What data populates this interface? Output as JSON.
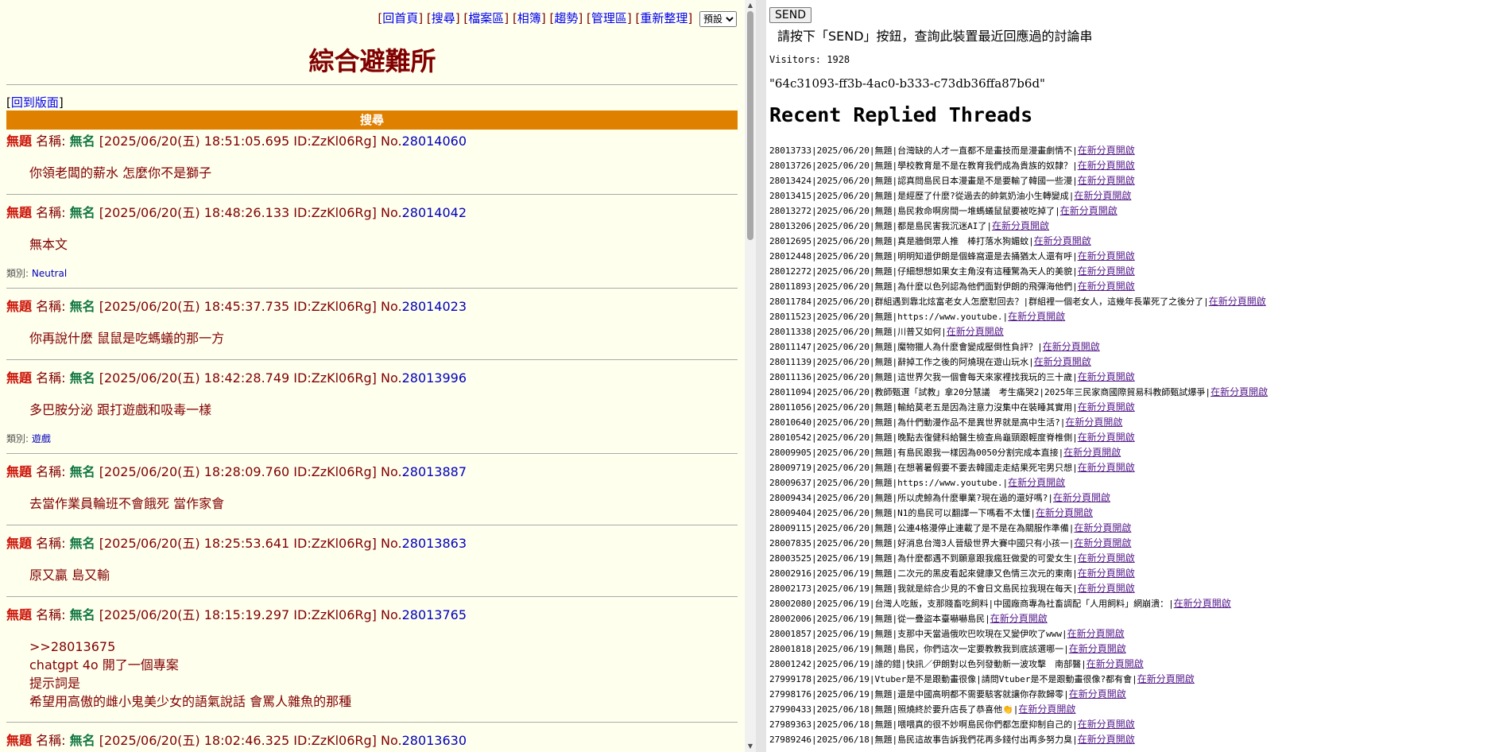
{
  "nav": {
    "home": "回首頁",
    "search": "搜尋",
    "archive": "檔案區",
    "album": "相簿",
    "trend": "趨勢",
    "admin": "管理區",
    "refresh": "重新整理",
    "sort_selected": "預設",
    "open": "[",
    "close": "]"
  },
  "board": {
    "title": "綜合避難所",
    "back_label": "回到版面",
    "search_bar": "搜尋"
  },
  "post_labels": {
    "name_label": "名稱: ",
    "no_prefix": "No.",
    "category_label": "類別: "
  },
  "posts": [
    {
      "subject": "無題",
      "name": "無名",
      "datetime": "[2025/06/20(五) 18:51:05.695 ID:ZzKl06Rg]",
      "no": "28014060",
      "lines": [
        "你領老闆的薪水 怎麼你不是獅子"
      ],
      "category": ""
    },
    {
      "subject": "無題",
      "name": "無名",
      "datetime": "[2025/06/20(五) 18:48:26.133 ID:ZzKl06Rg]",
      "no": "28014042",
      "lines": [
        "無本文"
      ],
      "category": "Neutral"
    },
    {
      "subject": "無題",
      "name": "無名",
      "datetime": "[2025/06/20(五) 18:45:37.735 ID:ZzKl06Rg]",
      "no": "28014023",
      "lines": [
        "你再說什麼 鼠鼠是吃螞蟻的那一方"
      ],
      "category": ""
    },
    {
      "subject": "無題",
      "name": "無名",
      "datetime": "[2025/06/20(五) 18:42:28.749 ID:ZzKl06Rg]",
      "no": "28013996",
      "lines": [
        "多巴胺分泌 跟打遊戲和吸毒一樣"
      ],
      "category": "遊戲"
    },
    {
      "subject": "無題",
      "name": "無名",
      "datetime": "[2025/06/20(五) 18:28:09.760 ID:ZzKl06Rg]",
      "no": "28013887",
      "lines": [
        "去當作業員輪班不會餓死 當作家會"
      ],
      "category": ""
    },
    {
      "subject": "無題",
      "name": "無名",
      "datetime": "[2025/06/20(五) 18:25:53.641 ID:ZzKl06Rg]",
      "no": "28013863",
      "lines": [
        "原又贏 島又輸"
      ],
      "category": ""
    },
    {
      "subject": "無題",
      "name": "無名",
      "datetime": "[2025/06/20(五) 18:15:19.297 ID:ZzKl06Rg]",
      "no": "28013765",
      "lines": [
        ">>28013675",
        "chatgpt 4o 開了一個專案",
        "提示詞是",
        "希望用高傲的雌小鬼美少女的語氣說話 會罵人雜魚的那種"
      ],
      "category": ""
    },
    {
      "subject": "無題",
      "name": "無名",
      "datetime": "[2025/06/20(五) 18:02:46.325 ID:ZzKl06Rg]",
      "no": "28013630",
      "lines": [],
      "category": ""
    }
  ],
  "right": {
    "send": "SEND",
    "prompt": "請按下「SEND」按鈕，查詢此裝置最近回應過的討論串",
    "visitors": "Visitors: 1928",
    "uuid": "\"64c31093-ff3b-4ac0-b333-c73db36ffa87b6d\"",
    "heading": "Recent Replied Threads",
    "link_label": "在新分頁開啟",
    "threads": [
      "28013733|2025/06/20|無題|台灣缺的人才一直都不是畫技而是漫畫劇情不|",
      "28013726|2025/06/20|無題|學校教育是不是在教育我們成為貴族的奴隸？|",
      "28013424|2025/06/20|無題|認真問島民日本漫畫是不是要輸了韓國一些漫|",
      "28013415|2025/06/20|無題|是經歷了什麼?從過去的帥氣奶油小生轉變成|",
      "28013272|2025/06/20|無題|島民救命啊房間一堆螞蟻鼠鼠要被吃掉了|",
      "28013206|2025/06/20|無題|都是島民害我沉迷AI了|",
      "28012695|2025/06/20|無題|真是牆倒眾人推　棒打落水狗媚蚊|",
      "28012448|2025/06/20|無題|明明知道伊朗是個蜂窩還是去捅猶太人還有呼|",
      "28012272|2025/06/20|無題|仔細想想如果女主角沒有這種驚為天人的美貌|",
      "28011893|2025/06/20|無題|為什麼以色列認為他們面對伊朗的飛彈海他們|",
      "28011784|2025/06/20|群組遇到靠北炫富老女人怎麼懟回去？|群組裡一個老女人，這幾年長輩死了之後分了|",
      "28011523|2025/06/20|無題|https://www.youtube.|",
      "28011338|2025/06/20|無題|川普又如何|",
      "28011147|2025/06/20|無題|魔物獵人為什麼會變成壓倒性負評？|",
      "28011139|2025/06/20|無題|辭掉工作之後的阿燒現在遊山玩水|",
      "28011136|2025/06/20|無題|這世界欠我一個會每天來家裡找我玩的三十歲|",
      "28011094|2025/06/20|教師甄選「試教」拿20分慧議　考生痛哭2|2025年三民家商國際貿易科教師甄試爆爭|",
      "28011056|2025/06/20|無題|輸給莫老五是因為注意力沒集中在裝睡其實用|",
      "28010640|2025/06/20|無題|為什們動漫作品不是異世界就是高中生活?|",
      "28010542|2025/06/20|無題|晚點去復健科給醫生檢查烏龜頸跟輕度脊椎側|",
      "28009905|2025/06/20|無題|有島民跟我一樣因為0050分割完成本直接|",
      "28009719|2025/06/20|無題|在想著暑假要不要去韓國走走結果死宅男只想|",
      "28009637|2025/06/20|無題|https://www.youtube.|",
      "28009434|2025/06/20|無題|所以虎鯨為什麼畢業?現在過的還好嗎?|",
      "28009404|2025/06/20|無題|N1的島民可以翻譯一下嗎看不太懂|",
      "28009115|2025/06/20|無題|公連4格漫停止連載了是不是在為關服作準備|",
      "28007835|2025/06/20|無題|好消息台灣3人晉級世界大賽中國只有小孩一|",
      "28003525|2025/06/19|無題|為什麼都遇不到願意跟我瘋狂做愛的可愛女生|",
      "28002916|2025/06/19|無題|二次元的黑皮看起來健康又色情三次元的東南|",
      "28002173|2025/06/19|無題|我就是綜合少見的不會日文島民拉我現在每天|",
      "28002080|2025/06/19|台灣人吃飯，支那賤畜吃飼料|中國廠商專為社畜調配「人用飼料」網崩潰：|",
      "28002006|2025/06/19|無題|從一疊盜本臺嚇嚇島民|",
      "28001857|2025/06/19|無題|支那中天當過俄吹巴吹現在又變伊吹了www|",
      "28001818|2025/06/19|無題|島民，你們這次一定要教教我到底該選哪一|",
      "28001242|2025/06/19|誰的錯|快訊／伊朗對以色列發動新一波攻擊　南部醫|",
      "27999178|2025/06/19|Vtuber是不是跟動畫很像|請問Vtuber是不是跟動畫很像?都有會|",
      "27998176|2025/06/19|無題|還是中國高明都不需要駭客就讓你存款歸零|",
      "27990433|2025/06/18|無題|照燒終於要升店長了恭喜他👏|",
      "27989363|2025/06/18|無題|喂喂真的很不妙啊島民你們都怎麼抑制自己的|",
      "27989246|2025/06/18|無題|島民這故事告訴我們花再多錢付出再多努力臭|"
    ]
  }
}
